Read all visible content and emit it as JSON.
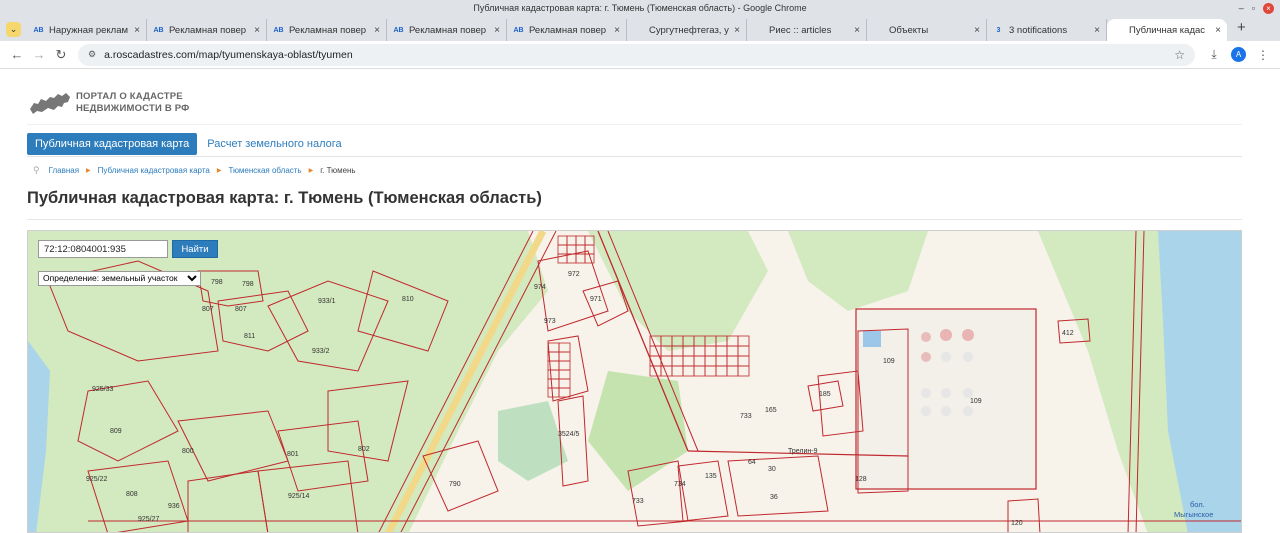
{
  "window": {
    "title": "Публичная кадастровая карта: г. Тюмень (Тюменская область) - Google Chrome"
  },
  "tabs": [
    {
      "icon": "AB",
      "label": "Наружная реклам",
      "active": false
    },
    {
      "icon": "AB",
      "label": "Рекламная повер",
      "active": false
    },
    {
      "icon": "AB",
      "label": "Рекламная повер",
      "active": false
    },
    {
      "icon": "AB",
      "label": "Рекламная повер",
      "active": false
    },
    {
      "icon": "AB",
      "label": "Рекламная повер",
      "active": false
    },
    {
      "icon": "",
      "label": "Сургутнефтегаз, у",
      "active": false
    },
    {
      "icon": "",
      "label": "Риес :: articles",
      "active": false
    },
    {
      "icon": "",
      "label": "Объекты",
      "active": false
    },
    {
      "icon": "3",
      "label": "3 notifications",
      "active": false
    },
    {
      "icon": "",
      "label": "Публичная кадас",
      "active": true
    }
  ],
  "addressbar": {
    "url": "a.roscadastres.com/map/tyumenskaya-oblast/tyumen",
    "avatar": "A"
  },
  "site": {
    "logo_line1": "ПОРТАЛ О КАДАСТРЕ",
    "logo_line2": "НЕДВИЖИМОСТИ В РФ",
    "nav_primary": "Публичная кадастровая карта",
    "nav_secondary": "Расчет земельного налога",
    "breadcrumb": [
      "Главная",
      "Публичная кадастровая карта",
      "Тюменская область",
      "г. Тюмень"
    ],
    "page_title": "Публичная кадастровая карта: г. Тюмень (Тюменская область)"
  },
  "map": {
    "search_value": "72:12:0804001:935",
    "search_button": "Найти",
    "definition_value": "Определение: земельный участок",
    "parcel_labels": [
      "972",
      "974",
      "971",
      "973",
      "798",
      "798",
      "807",
      "807",
      "811",
      "933/1",
      "810",
      "933/2",
      "925/33",
      "809",
      "800",
      "801",
      "802",
      "790",
      "925/22",
      "808",
      "936",
      "925/27",
      "925/14",
      "3524/5",
      "733",
      "734",
      "135",
      "165",
      "733",
      "185",
      "109",
      "109",
      "412",
      "64",
      "30",
      "36",
      "128",
      "120",
      "Трелин-9"
    ],
    "water_label_1": "бол.",
    "water_label_2": "Мыгынское",
    "colors": {
      "parcel_line": "#c0282d",
      "forest": "#cfe8b8",
      "water": "#a9d3ea",
      "road": "#f3d88a"
    }
  }
}
